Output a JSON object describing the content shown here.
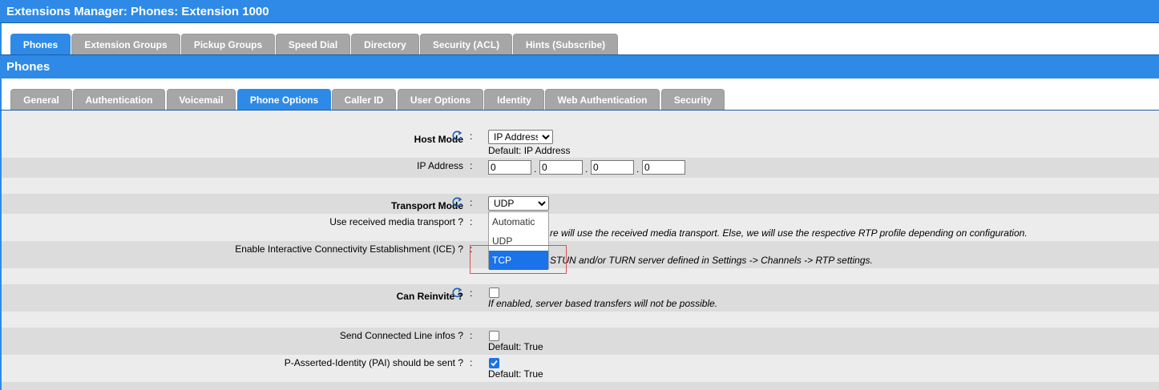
{
  "window": {
    "title": "Extensions Manager:  Phones:  Extension 1000"
  },
  "top_tabs": [
    {
      "label": "Phones",
      "active": true
    },
    {
      "label": "Extension Groups",
      "active": false
    },
    {
      "label": "Pickup Groups",
      "active": false
    },
    {
      "label": "Speed Dial",
      "active": false
    },
    {
      "label": "Directory",
      "active": false
    },
    {
      "label": "Security (ACL)",
      "active": false
    },
    {
      "label": "Hints (Subscribe)",
      "active": false
    }
  ],
  "section": {
    "title": "Phones"
  },
  "sub_tabs": [
    {
      "label": "General",
      "active": false
    },
    {
      "label": "Authentication",
      "active": false
    },
    {
      "label": "Voicemail",
      "active": false
    },
    {
      "label": "Phone Options",
      "active": true
    },
    {
      "label": "Caller ID",
      "active": false
    },
    {
      "label": "User Options",
      "active": false
    },
    {
      "label": "Identity",
      "active": false
    },
    {
      "label": "Web Authentication",
      "active": false
    },
    {
      "label": "Security",
      "active": false
    }
  ],
  "form": {
    "colon": ":",
    "host_mode": {
      "label": "Host Mode",
      "value": "IP Address",
      "default_text": "Default: IP Address"
    },
    "ip_address": {
      "label": "IP Address",
      "octets": [
        "0",
        "0",
        "0",
        "0"
      ],
      "separator": "."
    },
    "transport_mode": {
      "label": "Transport Mode",
      "value": "UDP",
      "options": [
        "Automatic",
        "UDP",
        "TCP"
      ],
      "highlighted": "TCP"
    },
    "use_received_media": {
      "label": "Use received media transport ?",
      "help_visible": "re will use the received media transport. Else, we will use the respective RTP profile depending on configuration."
    },
    "ice": {
      "label": "Enable Interactive Connectivity Establishment (ICE) ?",
      "help_visible": "STUN and/or TURN server defined in Settings -> Channels -> RTP settings."
    },
    "can_reinvite": {
      "label": "Can Reinvite ?",
      "checked": false,
      "help": "If enabled, server based transfers will not be possible."
    },
    "send_connected_line": {
      "label": "Send Connected Line infos ?",
      "checked": false,
      "default_text": "Default: True"
    },
    "pai": {
      "label": "P-Asserted-Identity (PAI) should be sent ?",
      "checked": true,
      "default_text": "Default: True"
    }
  },
  "colors": {
    "accent": "#2e8ae6",
    "tab_inactive": "#a6a6a6",
    "row_alt": "#dcdcdc",
    "row": "#ececec",
    "highlight": "#e05050"
  }
}
